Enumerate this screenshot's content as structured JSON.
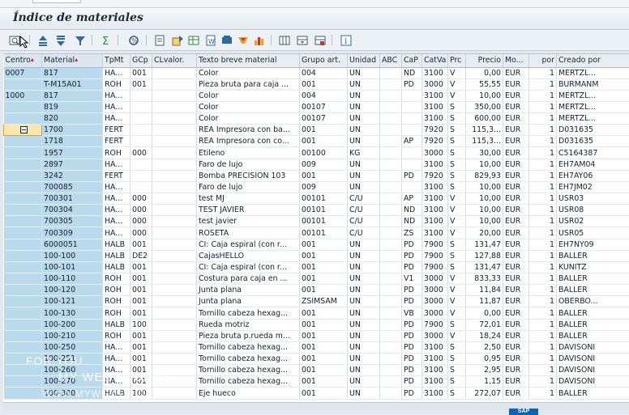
{
  "window": {
    "title": "Índice de materiales"
  },
  "toolbar": {
    "buttons": [
      {
        "name": "details-icon"
      },
      {
        "name": "sort-ascending-icon"
      },
      {
        "name": "sort-descending-icon"
      },
      {
        "name": "filter-icon"
      },
      {
        "name": "sum-icon"
      },
      {
        "name": "subtotal-icon"
      },
      {
        "name": "print-preview-icon"
      },
      {
        "name": "export-icon"
      },
      {
        "name": "spreadsheet-icon"
      },
      {
        "name": "word-processing-icon"
      },
      {
        "name": "local-file-icon"
      },
      {
        "name": "send-icon"
      },
      {
        "name": "graphic-icon"
      },
      {
        "name": "change-layout-icon"
      },
      {
        "name": "select-layout-icon"
      },
      {
        "name": "save-layout-icon"
      },
      {
        "name": "information-icon"
      }
    ]
  },
  "table": {
    "columns": [
      "Centro",
      "Material",
      "TpMt",
      "GCp",
      "CLvalor.",
      "Texto breve material",
      "Grupo art.",
      "Unidad",
      "ABC",
      "CaP",
      "CatVa",
      "Prc",
      "Precio",
      "Mo...",
      "por",
      "Creado por"
    ],
    "rows": [
      [
        "0007",
        "817",
        "HA...",
        "001",
        "",
        "Color",
        "004",
        "UN",
        "",
        "ND",
        "3100",
        "V",
        "0,00",
        "EUR",
        "1",
        "MERTZL..."
      ],
      [
        "",
        "T-M15A01",
        "ROH",
        "001",
        "",
        "Pieza bruta para caja ...",
        "001",
        "UN",
        "",
        "PD",
        "3000",
        "V",
        "55,55",
        "EUR",
        "1",
        "BURMANM"
      ],
      [
        "1000",
        "817",
        "HA...",
        "",
        "",
        "Color",
        "004",
        "UN",
        "",
        "",
        "3100",
        "V",
        "10,00",
        "EUR",
        "1",
        "MERTZL..."
      ],
      [
        "",
        "819",
        "HA...",
        "",
        "",
        "Color",
        "00107",
        "UN",
        "",
        "",
        "3100",
        "S",
        "350,00",
        "EUR",
        "1",
        "MERTZL..."
      ],
      [
        "",
        "820",
        "HA...",
        "",
        "",
        "Color",
        "00107",
        "UN",
        "",
        "",
        "3100",
        "S",
        "600,00",
        "EUR",
        "1",
        "MERTZL..."
      ],
      [
        "",
        "1700",
        "FERT",
        "",
        "",
        "REA Impresora con ba...",
        "001",
        "UN",
        "",
        "",
        "7920",
        "S",
        "115,3...",
        "EUR",
        "1",
        "D031635"
      ],
      [
        "",
        "1718",
        "FERT",
        "",
        "",
        "REA Impresora con co...",
        "001",
        "UN",
        "",
        "AP",
        "7920",
        "S",
        "115,3...",
        "EUR",
        "1",
        "D031635"
      ],
      [
        "",
        "1957",
        "ROH",
        "000",
        "",
        "Etileno",
        "00100",
        "KG",
        "",
        "",
        "3000",
        "S",
        "30,00",
        "EUR",
        "1",
        "C5164387"
      ],
      [
        "",
        "2897",
        "HA...",
        "",
        "",
        "Faro de lujo",
        "009",
        "UN",
        "",
        "",
        "3100",
        "S",
        "10,00",
        "EUR",
        "1",
        "EH7AM04"
      ],
      [
        "",
        "3242",
        "FERT",
        "",
        "",
        "Bomba PRECISION 103",
        "001",
        "UN",
        "",
        "PD",
        "7920",
        "S",
        "829,93",
        "EUR",
        "1",
        "EH7AY06"
      ],
      [
        "",
        "700085",
        "HA...",
        "",
        "",
        "Faro de lujo",
        "009",
        "UN",
        "",
        "",
        "3100",
        "S",
        "10,00",
        "EUR",
        "1",
        "EH7JM02"
      ],
      [
        "",
        "700301",
        "HA...",
        "000",
        "",
        "test MJ",
        "00101",
        "C/U",
        "",
        "AP",
        "3100",
        "V",
        "10,00",
        "EUR",
        "1",
        "USR03"
      ],
      [
        "",
        "700304",
        "HA...",
        "000",
        "",
        "TEST JAVIER",
        "00101",
        "C/U",
        "",
        "ND",
        "3100",
        "V",
        "10,00",
        "EUR",
        "1",
        "USR08"
      ],
      [
        "",
        "700305",
        "HA...",
        "000",
        "",
        "test javier",
        "00101",
        "C/U",
        "",
        "ND",
        "3100",
        "V",
        "10,00",
        "EUR",
        "1",
        "USR02"
      ],
      [
        "",
        "700309",
        "HA...",
        "000",
        "",
        "ROSETA",
        "00101",
        "C/U",
        "",
        "ZS",
        "3100",
        "V",
        "20,00",
        "EUR",
        "1",
        "USR05"
      ],
      [
        "",
        "6000051",
        "HALB",
        "001",
        "",
        "CI: Caja espiral (con r...",
        "001",
        "UN",
        "",
        "PD",
        "7900",
        "S",
        "131,47",
        "EUR",
        "1",
        "EH7NY09"
      ],
      [
        "",
        "100-100",
        "HALB",
        "DE2",
        "",
        "CajasHELLO",
        "001",
        "UN",
        "",
        "PD",
        "7900",
        "S",
        "127,88",
        "EUR",
        "1",
        "BALLER"
      ],
      [
        "",
        "100-101",
        "HALB",
        "001",
        "",
        "CI: Caja espiral (con r...",
        "001",
        "UN",
        "",
        "PD",
        "7900",
        "S",
        "131,47",
        "EUR",
        "1",
        "KUNITZ"
      ],
      [
        "",
        "100-110",
        "ROH",
        "001",
        "",
        "Costura para caja en ...",
        "001",
        "UN",
        "",
        "V1",
        "3000",
        "V",
        "833,33",
        "EUR",
        "1",
        "BALLER"
      ],
      [
        "",
        "100-120",
        "ROH",
        "001",
        "",
        "Junta plana",
        "001",
        "UN",
        "",
        "PD",
        "3000",
        "V",
        "11,84",
        "EUR",
        "1",
        "BALLER"
      ],
      [
        "",
        "100-121",
        "ROH",
        "001",
        "",
        "Junta plana",
        "ZSIMSAM",
        "UN",
        "",
        "PD",
        "3000",
        "V",
        "11,87",
        "EUR",
        "1",
        "OBERBO..."
      ],
      [
        "",
        "100-130",
        "ROH",
        "001",
        "",
        "Tornillo cabeza hexag...",
        "001",
        "UN",
        "",
        "VB",
        "3000",
        "V",
        "0,00",
        "EUR",
        "1",
        "BALLER"
      ],
      [
        "",
        "100-200",
        "HALB",
        "100",
        "",
        "Rueda motriz",
        "001",
        "UN",
        "",
        "PD",
        "7900",
        "S",
        "72,01",
        "EUR",
        "1",
        "BALLER"
      ],
      [
        "",
        "100-210",
        "ROH",
        "001",
        "",
        "Pieza bruta p.rueda m...",
        "001",
        "UN",
        "",
        "PD",
        "3000",
        "V",
        "18,24",
        "EUR",
        "1",
        "BALLER"
      ],
      [
        "",
        "100-250",
        "HA...",
        "001",
        "",
        "Tornillo cabeza hexag...",
        "001",
        "UN",
        "",
        "PD",
        "3100",
        "S",
        "2,50",
        "EUR",
        "1",
        "DAVISONI"
      ],
      [
        "",
        "100-251",
        "HA...",
        "001",
        "",
        "Tornillo cabeza hexag...",
        "001",
        "UN",
        "",
        "PD",
        "3100",
        "S",
        "0,95",
        "EUR",
        "1",
        "DAVISONI"
      ],
      [
        "",
        "100-260",
        "HA...",
        "001",
        "",
        "Tornillo cabeza hexag...",
        "001",
        "UN",
        "",
        "PD",
        "3100",
        "S",
        "2,95",
        "EUR",
        "1",
        "DAVISONI"
      ],
      [
        "",
        "100-270",
        "HA...",
        "001",
        "",
        "Tornillo cabeza hexag...",
        "001",
        "UN",
        "",
        "PD",
        "3100",
        "S",
        "1,15",
        "EUR",
        "1",
        "DAVISONI"
      ],
      [
        "",
        "100-300",
        "HALB",
        "100",
        "",
        "Eje hueco",
        "001",
        "UN",
        "",
        "PD",
        "3100",
        "S",
        "272,07",
        "EUR",
        "1",
        "BALLER"
      ]
    ]
  },
  "watermark": {
    "line1": "FOR YOU",
    "line2": "MY WEB STUDIES",
    "line3": "WWW.MYWEBSTUDIES.COM"
  },
  "footer": {
    "logo": "SAP"
  },
  "colors": {
    "key_column": "#b9daec",
    "header": "#e7edf3",
    "selected_cell": "#fde6b0",
    "sort_marker": "#d21f1f"
  }
}
